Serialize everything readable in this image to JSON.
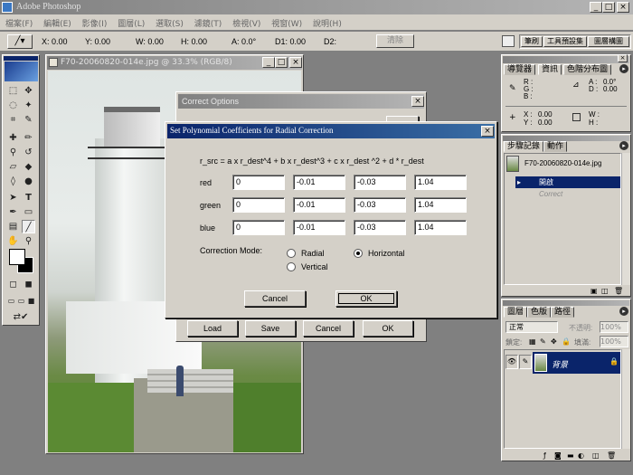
{
  "app": {
    "title": "Adobe Photoshop"
  },
  "menu": [
    "檔案(F)",
    "編輯(E)",
    "影像(I)",
    "圖層(L)",
    "選取(S)",
    "濾鏡(T)",
    "檢視(V)",
    "視窗(W)",
    "說明(H)"
  ],
  "options_bar": {
    "x": "X: 0.00",
    "y": "Y: 0.00",
    "w": "W: 0.00",
    "h": "H: 0.00",
    "a": "A: 0.0°",
    "d1": "D1: 0.00",
    "d2": "D2:",
    "clear": "清除"
  },
  "palette_well_tabs": [
    "筆刷",
    "工具預設集",
    "圖層構圖"
  ],
  "document": {
    "title": "F70-20060820-014e.jpg @ 33.3% (RGB/8)"
  },
  "info_panel": {
    "tabs": [
      "導覽器",
      "資訊",
      "色階分布圖"
    ],
    "rgb": {
      "r": "R :",
      "g": "G :",
      "b": "B :"
    },
    "acd": {
      "a": "A :",
      "a_val": "0.0°",
      "d": "D :",
      "d_val": "0.00"
    },
    "xy": {
      "x": "X :",
      "x_val": "0.00",
      "y": "Y :",
      "y_val": "0.00"
    },
    "wh": {
      "w": "W :",
      "h": "H :"
    }
  },
  "history_panel": {
    "tabs": [
      "步驟記錄",
      "動作"
    ],
    "snapshot": "F70-20060820-014e.jpg",
    "items": [
      "開啟",
      "Correct"
    ]
  },
  "layers_panel": {
    "tabs": [
      "圖層",
      "色版",
      "路徑"
    ],
    "blend_mode": "正常",
    "opacity_label": "不透明:",
    "opacity_value": "100%",
    "lock_label": "鎖定:",
    "fill_label": "填滿:",
    "fill_value": "100%",
    "layer_name": "背景"
  },
  "correct_options": {
    "title": "Correct Options",
    "buttons": [
      "Load",
      "Save",
      "Cancel",
      "OK"
    ]
  },
  "dialog": {
    "title": "Set Polynomial Coefficients for Radial Correction",
    "formula": "r_src =  a x r_dest^4  +  b x r_dest^3  +  c x r_dest ^2  +  d * r_dest",
    "rows": [
      {
        "label": "red",
        "values": [
          "0",
          "-0.01",
          "-0.03",
          "1.04"
        ]
      },
      {
        "label": "green",
        "values": [
          "0",
          "-0.01",
          "-0.03",
          "1.04"
        ]
      },
      {
        "label": "blue",
        "values": [
          "0",
          "-0.01",
          "-0.03",
          "1.04"
        ]
      }
    ],
    "mode_label": "Correction Mode:",
    "modes": {
      "radial": "Radial",
      "horizontal": "Horizontal",
      "vertical": "Vertical",
      "selected": "Horizontal"
    },
    "cancel": "Cancel",
    "ok": "OK"
  }
}
